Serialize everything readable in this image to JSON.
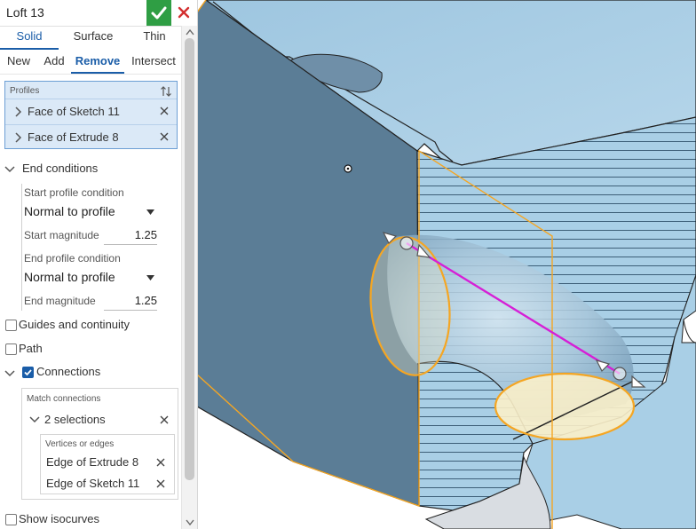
{
  "feature": {
    "title": "Loft 13"
  },
  "tabs": [
    {
      "label": "Solid",
      "active": true
    },
    {
      "label": "Surface",
      "active": false
    },
    {
      "label": "Thin",
      "active": false
    }
  ],
  "operations": [
    {
      "label": "New",
      "active": false
    },
    {
      "label": "Add",
      "active": false
    },
    {
      "label": "Remove",
      "active": true
    },
    {
      "label": "Intersect",
      "active": false
    }
  ],
  "profiles": {
    "label": "Profiles",
    "items": [
      "Face of Sketch 11",
      "Face of Extrude 8"
    ]
  },
  "end_conditions": {
    "label": "End conditions",
    "start_condition_label": "Start profile condition",
    "start_condition_value": "Normal to profile",
    "start_magnitude_label": "Start magnitude",
    "start_magnitude_value": "1.25",
    "end_condition_label": "End profile condition",
    "end_condition_value": "Normal to profile",
    "end_magnitude_label": "End magnitude",
    "end_magnitude_value": "1.25"
  },
  "options": {
    "guides_label": "Guides and continuity",
    "guides_checked": false,
    "path_label": "Path",
    "path_checked": false,
    "connections_label": "Connections",
    "connections_checked": true,
    "show_isocurves_label": "Show isocurves",
    "show_isocurves_checked": false
  },
  "connections": {
    "match_label": "Match connections",
    "selection_label": "2 selections",
    "vertices_label": "Vertices or edges",
    "edges": [
      "Edge of Extrude 8",
      "Edge of Sketch 11"
    ]
  },
  "colors": {
    "accent": "#1a5da8",
    "confirm": "#2f9e44",
    "cancel": "#d32f2f",
    "part_face": "#a9cfe6",
    "part_face_dark": "#5b7d96",
    "highlight_orange": "#f5a623",
    "connector_magenta": "#d61fd6"
  }
}
